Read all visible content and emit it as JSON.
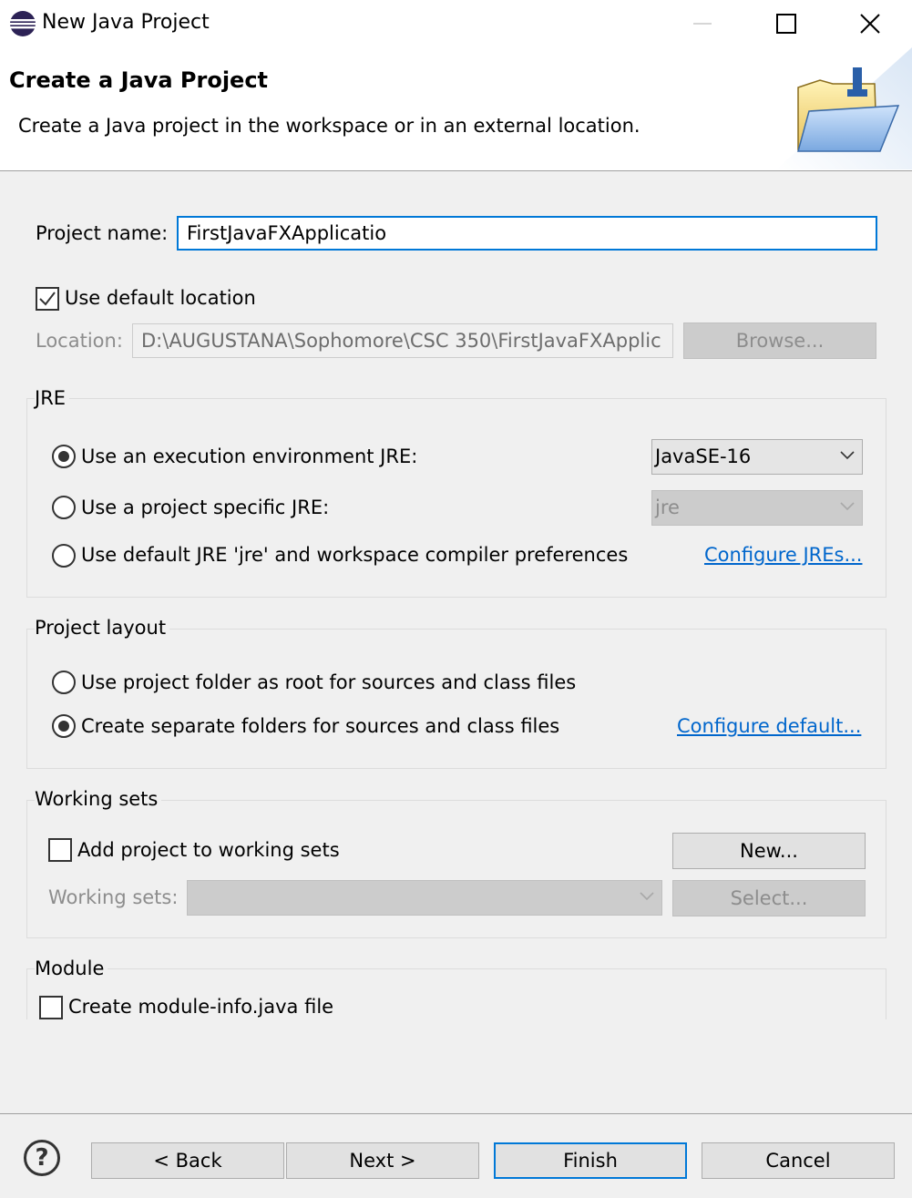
{
  "window": {
    "title": "New Java Project",
    "icon": "eclipse-icon"
  },
  "header": {
    "title": "Create a Java Project",
    "description": "Create a Java project in the workspace or in an external location.",
    "image": "java-project-wizard-folder-icon"
  },
  "project": {
    "name_label": "Project name:",
    "name_value": "FirstJavaFXApplicatio",
    "use_default_location_label": "Use default location",
    "use_default_location_checked": true,
    "location_label": "Location:",
    "location_value": "D:\\AUGUSTANA\\Sophomore\\CSC 350\\FirstJavaFXApplic",
    "browse_label": "Browse..."
  },
  "jre": {
    "group_title": "JRE",
    "option_execution_env": "Use an execution environment JRE:",
    "option_project_specific": "Use a project specific JRE:",
    "option_default": "Use default JRE 'jre' and workspace compiler preferences",
    "selected": "execution_env",
    "execution_env_value": "JavaSE-16",
    "project_specific_value": "jre",
    "configure_link": "Configure JREs..."
  },
  "layout": {
    "group_title": "Project layout",
    "option_root": "Use project folder as root for sources and class files",
    "option_separate": "Create separate folders for sources and class files",
    "selected": "separate",
    "configure_link": "Configure default..."
  },
  "working_sets": {
    "group_title": "Working sets",
    "add_label": "Add project to working sets",
    "add_checked": false,
    "new_button": "New...",
    "sets_label": "Working sets:",
    "sets_value": "",
    "select_button": "Select..."
  },
  "module": {
    "group_title": "Module",
    "create_label": "Create module-info.java file",
    "create_checked": false
  },
  "footer": {
    "help": "?",
    "back": "< Back",
    "next": "Next >",
    "finish": "Finish",
    "cancel": "Cancel"
  },
  "colors": {
    "accent": "#0078d7",
    "link": "#0066cc",
    "background": "#f0f0f0"
  }
}
